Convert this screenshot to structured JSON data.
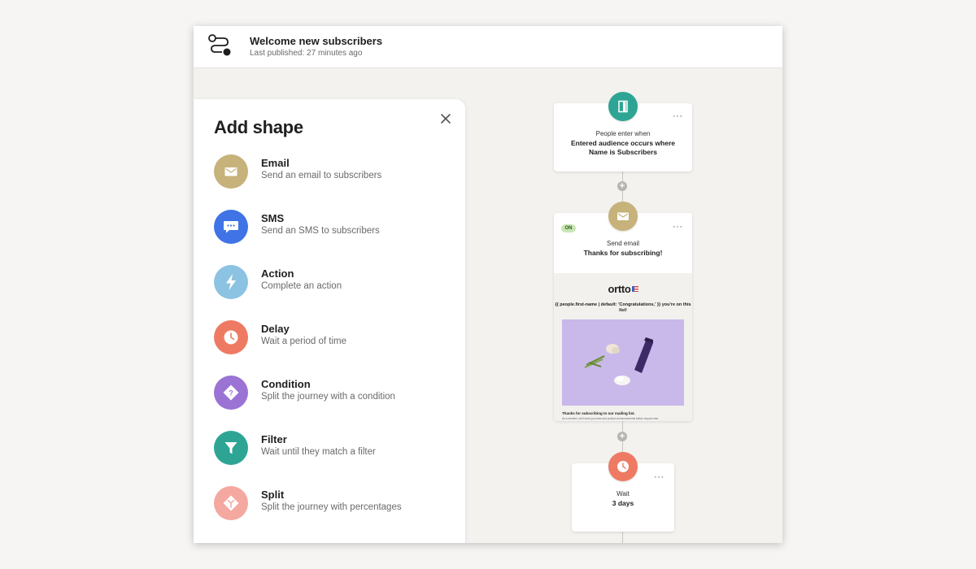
{
  "header": {
    "title": "Welcome new subscribers",
    "subtitle": "Last published: 27 minutes ago"
  },
  "panel": {
    "title": "Add shape",
    "items": [
      {
        "name": "Email",
        "desc": "Send an email to subscribers",
        "icon": "envelope-icon",
        "color": "#c6b27a"
      },
      {
        "name": "SMS",
        "desc": "Send an SMS to subscribers",
        "icon": "chat-bubble-icon",
        "color": "#3f73e6"
      },
      {
        "name": "Action",
        "desc": "Complete an action",
        "icon": "lightning-icon",
        "color": "#8cc3e2"
      },
      {
        "name": "Delay",
        "desc": "Wait a period of time",
        "icon": "clock-icon",
        "color": "#ee7a63"
      },
      {
        "name": "Condition",
        "desc": "Split the journey with a condition",
        "icon": "question-diamond-icon",
        "color": "#9a73d4"
      },
      {
        "name": "Filter",
        "desc": "Wait until they match a filter",
        "icon": "funnel-icon",
        "color": "#2ea594"
      },
      {
        "name": "Split",
        "desc": "Split the journey with percentages",
        "icon": "split-arrows-icon",
        "color": "#f4a8a0"
      }
    ]
  },
  "flow": {
    "entry": {
      "label": "People enter when",
      "value": "Entered audience occurs where Name is Subscribers",
      "menu": "···",
      "icon": "door-icon",
      "color": "#2ea594"
    },
    "email": {
      "badge": "ON",
      "label": "Send email",
      "value": "Thanks for subscribing!",
      "menu": "···",
      "icon": "envelope-icon",
      "color": "#c6b27a",
      "preview": {
        "brand": "ortto",
        "merge_text": "{{ people.first-name | default: 'Congratulations,' }} you're on this list!",
        "body_title": "Thanks for subscribing to our mailing list.",
        "body_text": "As a member, we'll send you news and product announcements before anyone else."
      }
    },
    "delay": {
      "label": "Wait",
      "value": "3 days",
      "menu": "···",
      "icon": "clock-icon",
      "color": "#ee7a63"
    },
    "add_step": "+"
  }
}
